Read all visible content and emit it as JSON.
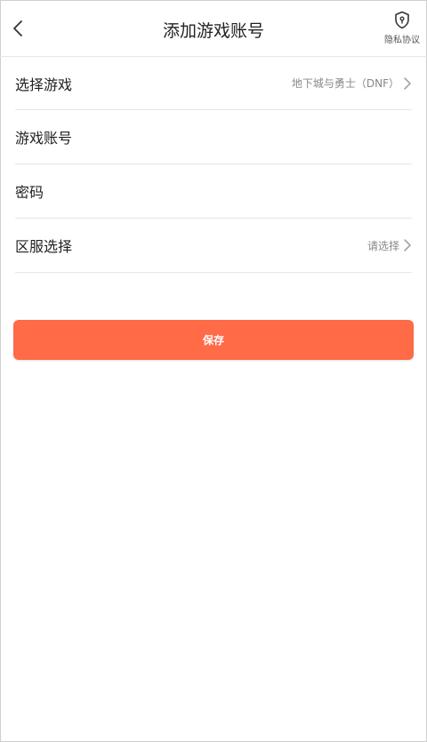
{
  "header": {
    "title": "添加游戏账号",
    "privacy_label": "隐私协议"
  },
  "form": {
    "game": {
      "label": "选择游戏",
      "value": "地下城与勇士（DNF）"
    },
    "account": {
      "label": "游戏账号",
      "value": "",
      "placeholder": ""
    },
    "password": {
      "label": "密码",
      "value": "",
      "placeholder": ""
    },
    "server": {
      "label": "区服选择",
      "value": "请选择"
    }
  },
  "actions": {
    "save_label": "保存"
  },
  "colors": {
    "accent": "#ff6a47",
    "divider": "#e6e6e6",
    "secondary_text": "#888888"
  },
  "icons": {
    "back": "chevron-left-icon",
    "privacy": "shield-lock-icon",
    "chevron": "chevron-right-icon"
  }
}
